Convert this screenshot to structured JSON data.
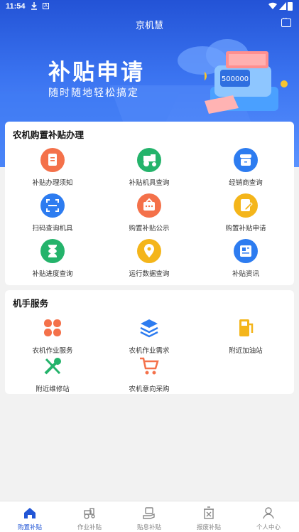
{
  "status_bar": {
    "time": "11:54",
    "extra_badge": "A"
  },
  "app_bar": {
    "title": "京机慧"
  },
  "banner": {
    "title": "补贴申请",
    "subtitle": "随时随地轻松搞定",
    "machine_label": "500000"
  },
  "section_subsidy": {
    "title": "农机购置补贴办理",
    "items": [
      {
        "label": "补贴办理须知",
        "icon": "document-icon",
        "color": "#f4714a"
      },
      {
        "label": "补贴机具查询",
        "icon": "tractor-icon",
        "color": "#24b36b"
      },
      {
        "label": "经销商查询",
        "icon": "store-icon",
        "color": "#2d7cf0"
      },
      {
        "label": "扫码查询机具",
        "icon": "scan-icon",
        "color": "#2d7cf0"
      },
      {
        "label": "购置补贴公示",
        "icon": "announce-icon",
        "color": "#f4714a"
      },
      {
        "label": "购置补贴申请",
        "icon": "apply-icon",
        "color": "#f4b51a"
      },
      {
        "label": "补贴进度查询",
        "icon": "hourglass-icon",
        "color": "#24b36b"
      },
      {
        "label": "运行数据查询",
        "icon": "location-icon",
        "color": "#f4b51a"
      },
      {
        "label": "补贴资讯",
        "icon": "news-icon",
        "color": "#2d7cf0"
      }
    ]
  },
  "section_operator": {
    "title": "机手服务",
    "items": [
      {
        "label": "农机作业服务",
        "icon": "petal-icon",
        "color": "#f4714a"
      },
      {
        "label": "农机作业需求",
        "icon": "layers-icon",
        "color": "#2d7cf0"
      },
      {
        "label": "附近加油站",
        "icon": "fuel-icon",
        "color": "#f4b51a"
      },
      {
        "label": "附近维修站",
        "icon": "tools-icon",
        "color": "#24b36b"
      },
      {
        "label": "农机意向采购",
        "icon": "cart-icon",
        "color": "#f4714a"
      }
    ]
  },
  "tabbar": {
    "active_color": "#2256d6",
    "tabs": [
      {
        "label": "购置补贴",
        "icon": "home-icon"
      },
      {
        "label": "作业补贴",
        "icon": "tractor-outline-icon"
      },
      {
        "label": "贴息补贴",
        "icon": "money-hand-icon"
      },
      {
        "label": "报废补贴",
        "icon": "trash-box-icon"
      },
      {
        "label": "个人中心",
        "icon": "person-icon"
      }
    ]
  }
}
